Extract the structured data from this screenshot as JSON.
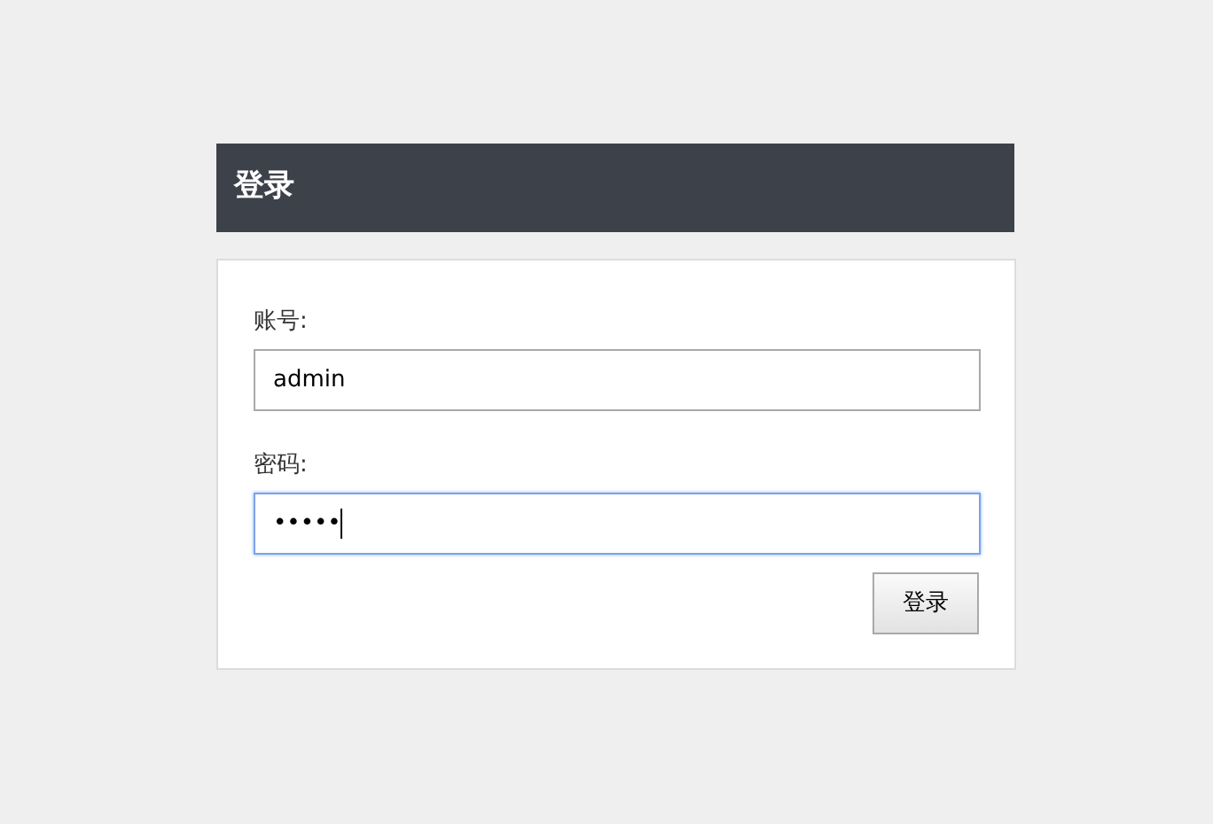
{
  "header": {
    "title": "登录"
  },
  "fields": [
    {
      "label": "账号:",
      "value": "admin",
      "focused": false
    },
    {
      "label": "密码:",
      "value": "•••••",
      "focused": true
    }
  ],
  "buttons": [
    "登录"
  ]
}
